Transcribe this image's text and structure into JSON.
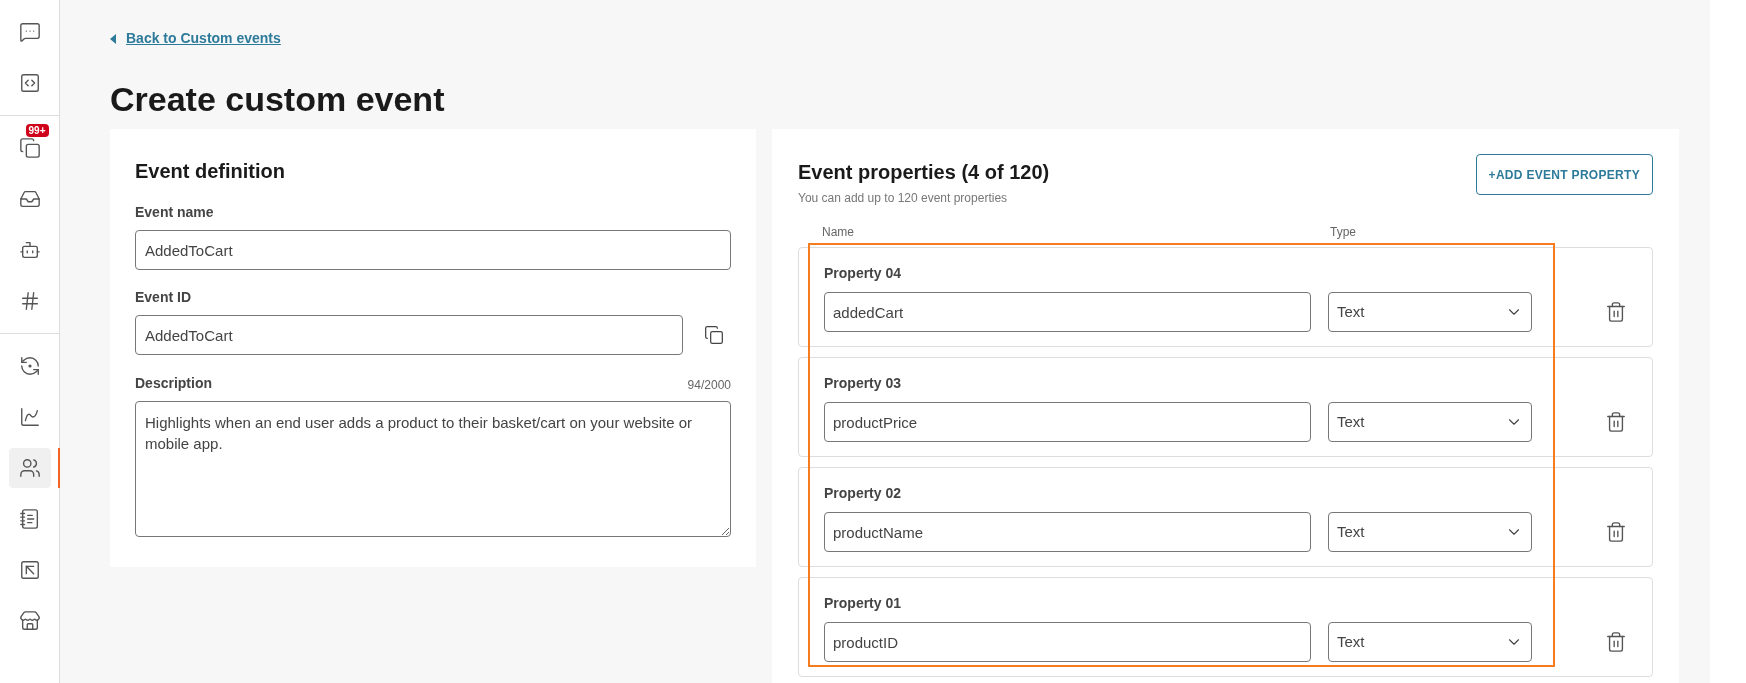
{
  "sidebar": {
    "groups": [
      [
        {
          "kind": "chat",
          "selected": false
        },
        {
          "kind": "code",
          "selected": false
        }
      ],
      [
        {
          "kind": "copy",
          "selected": false,
          "badge": "99+"
        },
        {
          "kind": "tray",
          "selected": false
        },
        {
          "kind": "robot",
          "selected": false
        },
        {
          "kind": "hash",
          "selected": false
        }
      ],
      [
        {
          "kind": "sync",
          "selected": false
        },
        {
          "kind": "chart",
          "selected": false
        },
        {
          "kind": "people",
          "selected": true
        },
        {
          "kind": "book",
          "selected": false
        },
        {
          "kind": "frame",
          "selected": false
        },
        {
          "kind": "store",
          "selected": false
        }
      ]
    ]
  },
  "back_link": "Back to Custom events",
  "title": "Create custom event",
  "definition": {
    "heading": "Event definition",
    "event_name": {
      "label": "Event name",
      "value": "AddedToCart"
    },
    "event_id": {
      "label": "Event ID",
      "value": "AddedToCart"
    },
    "description": {
      "label": "Description",
      "counter": "94/2000",
      "value": "Highlights when an end user adds a product to their basket/cart on your website or mobile app."
    }
  },
  "properties": {
    "heading": "Event properties (4 of 120)",
    "subtitle": "You can add up to 120 event properties",
    "add_button": "+ADD EVENT PROPERTY",
    "highlighted": true,
    "columns": [
      "Name",
      "Type"
    ],
    "rows": [
      {
        "label": "Property 04",
        "name": "addedCart",
        "type": "Text"
      },
      {
        "label": "Property 03",
        "name": "productPrice",
        "type": "Text"
      },
      {
        "label": "Property 02",
        "name": "productName",
        "type": "Text"
      },
      {
        "label": "Property 01",
        "name": "productID",
        "type": "Text"
      }
    ]
  }
}
